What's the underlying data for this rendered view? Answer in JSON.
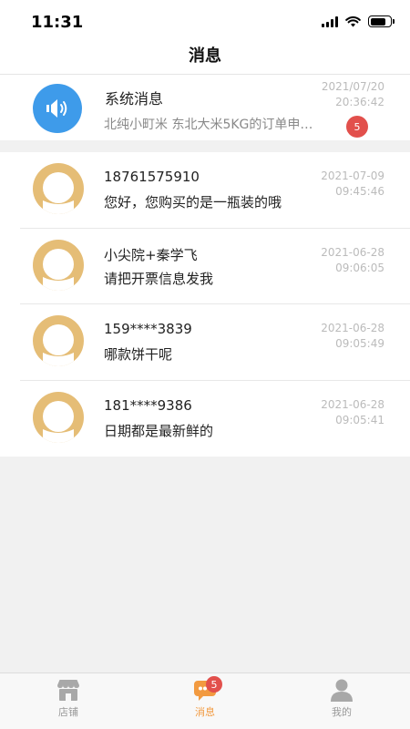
{
  "status_bar": {
    "time": "11:31"
  },
  "nav": {
    "title": "消息"
  },
  "system_message": {
    "title": "系统消息",
    "preview": "北纯小町米 东北大米5KG的订单申…",
    "date": "2021/07/20",
    "time": "20:36:42",
    "unread": "5",
    "icon": "speaker-icon"
  },
  "chats": [
    {
      "name": "18761575910",
      "message": "您好，您购买的是一瓶装的哦",
      "date": "2021-07-09",
      "time": "09:45:46"
    },
    {
      "name": "小尖院+秦学飞",
      "message": "请把开票信息发我",
      "date": "2021-06-28",
      "time": "09:06:05"
    },
    {
      "name": "159****3839",
      "message": "哪款饼干呢",
      "date": "2021-06-28",
      "time": "09:05:49"
    },
    {
      "name": "181****9386",
      "message": "日期都是最新鲜的",
      "date": "2021-06-28",
      "time": "09:05:41"
    }
  ],
  "tab_bar": {
    "shop": {
      "label": "店铺",
      "icon": "store-icon"
    },
    "messages": {
      "label": "消息",
      "icon": "chat-bubble-icon",
      "badge": "5",
      "active": true
    },
    "me": {
      "label": "我的",
      "icon": "person-icon"
    }
  },
  "colors": {
    "accent": "#f29a40",
    "badge": "#e2504c",
    "system_icon_bg": "#3e9bea",
    "avatar_bg": "#e5bd76"
  }
}
